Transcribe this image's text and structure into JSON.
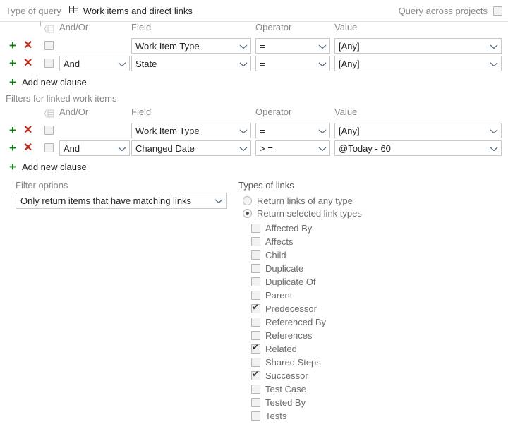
{
  "topbar": {
    "type_of_query_label": "Type of query",
    "query_type_value": "Work items and direct links",
    "query_type_icon": "grid-icon",
    "query_across_projects_label": "Query across projects",
    "query_across_projects_checked": false
  },
  "columns": {
    "andor": "And/Or",
    "field": "Field",
    "operator": "Operator",
    "value": "Value"
  },
  "icons": {
    "add": "+",
    "delete": "✕",
    "group": "group-clauses-icon",
    "chevron": "chevron-down-icon"
  },
  "top_group": {
    "rows": [
      {
        "selected": false,
        "andor": "",
        "field": "Work Item Type",
        "operator": "=",
        "value": "[Any]"
      },
      {
        "selected": false,
        "andor": "And",
        "field": "State",
        "operator": "=",
        "value": "[Any]"
      }
    ],
    "add_new_clause_label": "Add new clause"
  },
  "linked_section": {
    "title": "Filters for linked work items",
    "rows": [
      {
        "selected": false,
        "andor": "",
        "field": "Work Item Type",
        "operator": "=",
        "value": "[Any]"
      },
      {
        "selected": false,
        "andor": "And",
        "field": "Changed Date",
        "operator": "> =",
        "value": "@Today - 60"
      }
    ],
    "add_new_clause_label": "Add new clause"
  },
  "filter_options": {
    "label": "Filter options",
    "value": "Only return items that have matching links"
  },
  "types_of_links": {
    "title": "Types of links",
    "mode": "selected",
    "radios": [
      {
        "id": "any",
        "label": "Return links of any type",
        "selected": false
      },
      {
        "id": "selected",
        "label": "Return selected link types",
        "selected": true
      }
    ],
    "link_types": [
      {
        "label": "Affected By",
        "checked": false
      },
      {
        "label": "Affects",
        "checked": false
      },
      {
        "label": "Child",
        "checked": false
      },
      {
        "label": "Duplicate",
        "checked": false
      },
      {
        "label": "Duplicate Of",
        "checked": false
      },
      {
        "label": "Parent",
        "checked": false
      },
      {
        "label": "Predecessor",
        "checked": true
      },
      {
        "label": "Referenced By",
        "checked": false
      },
      {
        "label": "References",
        "checked": false
      },
      {
        "label": "Related",
        "checked": true
      },
      {
        "label": "Shared Steps",
        "checked": false
      },
      {
        "label": "Successor",
        "checked": true
      },
      {
        "label": "Test Case",
        "checked": false
      },
      {
        "label": "Tested By",
        "checked": false
      },
      {
        "label": "Tests",
        "checked": false
      }
    ]
  },
  "colors": {
    "add_green": "#107c10",
    "delete_red": "#c42b1c",
    "label_gray": "#8a8886",
    "border": "#c9c9c9"
  }
}
